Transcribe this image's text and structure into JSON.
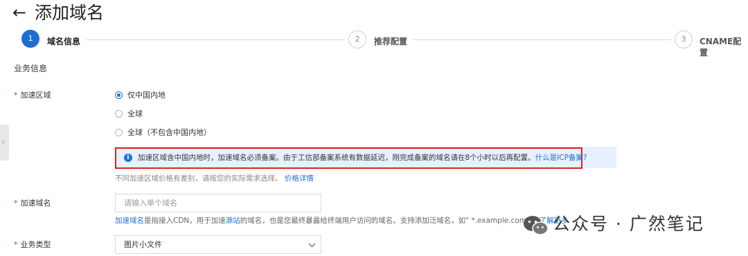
{
  "header": {
    "back_icon": "←",
    "title": "添加域名"
  },
  "steps": [
    {
      "number": "1",
      "label": "域名信息",
      "state": "active"
    },
    {
      "number": "2",
      "label": "推荐配置",
      "state": "idle"
    },
    {
      "number": "3",
      "label": "CNAME配置",
      "state": "idle"
    }
  ],
  "section": {
    "title": "业务信息"
  },
  "region": {
    "required_mark": "*",
    "label": "加速区域",
    "options": [
      "仅中国内地",
      "全球",
      "全球（不包含中国内地）"
    ],
    "selected": "仅中国内地"
  },
  "notice": {
    "icon": "i",
    "text": "加速区域含中国内地时，加速域名必须备案。由于工信部备案系统有数据延迟，刚完成备案的域名请在8个小时以后再配置。",
    "link": "什么是ICP备案?"
  },
  "price_hint": {
    "text": "不同加速区域价格有差别，请按您的实际需求选择。",
    "link": "价格详情"
  },
  "domain": {
    "required_mark": "*",
    "label": "加速域名",
    "placeholder": "请输入单个域名",
    "value": "",
    "hint_link1": "加速域名",
    "hint_text1": "是指接入CDN，用于加速",
    "hint_link2": "源站",
    "hint_text2": "的域名，也是您最终暴露给终端用户访问的域名。支持添加泛域名，如\" *.example.com \"，",
    "hint_link3": "了解更多"
  },
  "biz_type": {
    "required_mark": "*",
    "label": "业务类型",
    "selected": "图片小文件"
  },
  "watermark": {
    "text": "公众号 · 广然笔记"
  },
  "colors": {
    "primary": "#1f6fd1",
    "required": "#e0302a",
    "notice_bg": "#e6f1fd",
    "highlight_border": "#e02020"
  }
}
